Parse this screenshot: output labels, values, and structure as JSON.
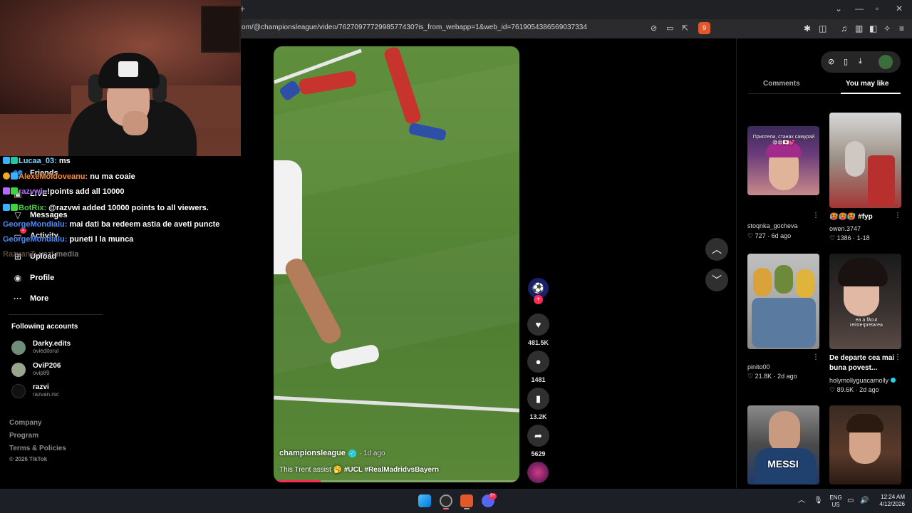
{
  "browser": {
    "url": "om/@championsleague/video/7627097772998577430?is_from_webapp=1&web_id=7619054386569037334",
    "new_tab": "+",
    "brave_badge": "9"
  },
  "sidebar": {
    "nav": [
      {
        "label": "Friends",
        "icon": "friends-icon"
      },
      {
        "label": "LIVE",
        "icon": "live-icon"
      },
      {
        "label": "Messages",
        "icon": "messages-icon"
      },
      {
        "label": "Activity",
        "icon": "activity-icon"
      },
      {
        "label": "Upload",
        "icon": "upload-icon"
      },
      {
        "label": "Profile",
        "icon": "profile-icon"
      },
      {
        "label": "More",
        "icon": "more-icon"
      }
    ],
    "activity_badge": "5",
    "following_title": "Following accounts",
    "accounts": [
      {
        "name": "Darky.edits",
        "handle": "ovieditorul"
      },
      {
        "name": "OviP206",
        "handle": "ovip89"
      },
      {
        "name": "razvi",
        "handle": "razvan.rsc"
      }
    ],
    "footer": [
      "Company",
      "Program",
      "Terms & Policies"
    ],
    "copyright": "© 2026 TikTok"
  },
  "chat": [
    {
      "user": "Lucaa_03:",
      "msg": "ms",
      "color": "#7fd4ff"
    },
    {
      "user": "AlexeMoldoveanu:",
      "msg": "nu ma coaie",
      "color": "#ff8c2a"
    },
    {
      "user": "razvwi:",
      "msg": "!points add all 10000",
      "color": "#b46aff"
    },
    {
      "user": "BotRix:",
      "msg": "@razvwi added 10000 points to all viewers.",
      "color": "#3fd43f"
    },
    {
      "user": "GeorgeMondialu:",
      "msg": "mai dati ba redeem astia de aveti puncte",
      "color": "#4a8cff"
    },
    {
      "user": "GeorgeMondialu:",
      "msg": "puneti l la munca",
      "color": "#4a8cff"
    },
    {
      "user": "RazvanT:",
      "msg": "vezi media",
      "color": "#c0a080"
    }
  ],
  "video": {
    "author": "championsleague",
    "posted": "· 1d ago",
    "caption": "This Trent assist 🥱",
    "hashtags": "#UCL #RealMadridvsBayern",
    "progress": 0.19
  },
  "actions": {
    "likes": "481.5K",
    "comments": "1481",
    "saves": "13.2K",
    "shares": "5629"
  },
  "right_panel": {
    "tabs": [
      "Comments",
      "You may like"
    ],
    "active_tab": "You may like",
    "videos": [
      {
        "thumb_text": "Приятели, станах самурай 😅😄🇯🇵💕",
        "title": "",
        "author": "stoqnka_gocheva",
        "likes": "727",
        "date": "6d ago",
        "meta": "727 · 6d ago"
      },
      {
        "thumb_text": "",
        "title": "🥵🥵🥵 #fyp",
        "author": "owen.3747",
        "likes": "1386",
        "date": "1-18",
        "meta": "1386 · 1-18"
      },
      {
        "thumb_text": "",
        "title": "",
        "author": "pinito00",
        "likes": "21.8K",
        "date": "2d ago",
        "meta": "21.8K · 2d ago"
      },
      {
        "thumb_text": "ea a făcut reinterpretarea",
        "title": "De departe cea mai buna povest...",
        "author": "holymollyguacamolly",
        "likes": "89.6K",
        "date": "2d ago",
        "meta": "89.6K · 2d ago"
      },
      {
        "thumb_text": "MESSI",
        "title": "",
        "author": "",
        "likes": "",
        "date": "",
        "meta": ""
      },
      {
        "thumb_text": "",
        "title": "",
        "author": "",
        "likes": "",
        "date": "",
        "meta": ""
      }
    ]
  },
  "taskbar": {
    "discord_badge": "9+",
    "lang": "ENG",
    "region": "US",
    "time": "12:24 AM",
    "date": "4/12/2026"
  },
  "colors": {
    "accent": "#fe2c55",
    "verified": "#20d5ec"
  }
}
